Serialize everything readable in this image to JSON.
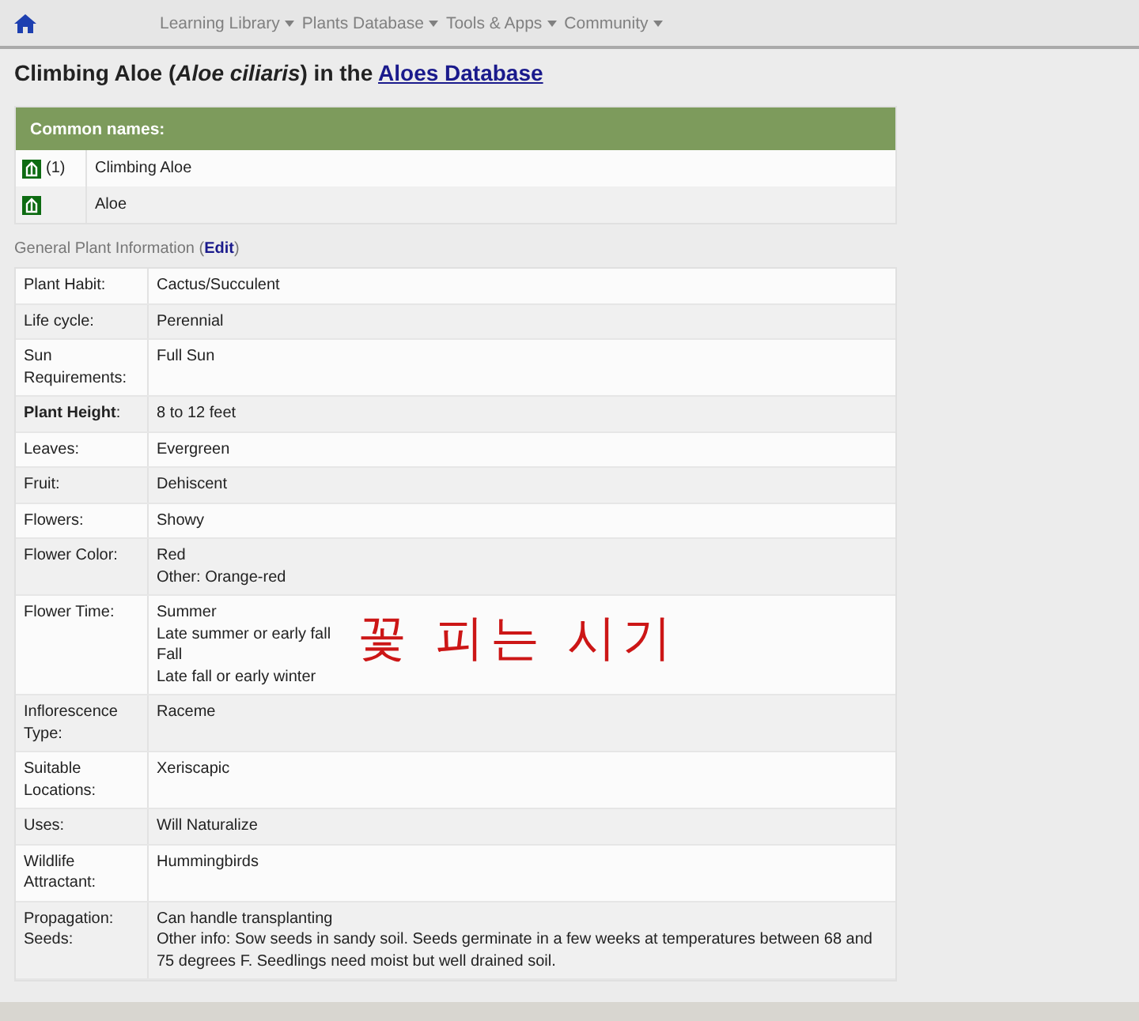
{
  "nav": {
    "menus": [
      "Learning Library",
      "Plants Database",
      "Tools & Apps",
      "Community"
    ]
  },
  "title": {
    "text": "Climbing Aloe (*Aloe ciliaris*) in the",
    "link": "Aloes Database"
  },
  "common_names": {
    "heading": "Common names:",
    "rows": [
      {
        "count": "(1)",
        "name": "Climbing Aloe"
      },
      {
        "name": "Aloe"
      }
    ]
  },
  "general": {
    "heading": "General Plant Information (",
    "edit": "Edit",
    "close": ")"
  },
  "info_rows": [
    {
      "label": "Plant Habit:",
      "values": [
        "Cactus/Succulent"
      ]
    },
    {
      "label": "Life cycle:",
      "values": [
        "Perennial"
      ]
    },
    {
      "label": "Sun Requirements:",
      "values": [
        "Full Sun"
      ]
    },
    {
      "label": "**Plant Height**:",
      "values": [
        "8 to 12 feet"
      ]
    },
    {
      "label": "Leaves:",
      "values": [
        "Evergreen"
      ]
    },
    {
      "label": "Fruit:",
      "values": [
        "Dehiscent"
      ]
    },
    {
      "label": "Flowers:",
      "values": [
        "Showy"
      ]
    },
    {
      "label": "Flower Color:",
      "values": [
        "Red",
        "Other: Orange-red"
      ]
    },
    {
      "label": "Flower Time:",
      "values": [
        "Summer",
        "Late summer or early fall",
        "Fall",
        "Late fall or early winter"
      ],
      "annotation": "꽃 피는 시기"
    },
    {
      "label": "Inflorescence Type:",
      "values": [
        "Raceme"
      ]
    },
    {
      "label": "Suitable Locations:",
      "values": [
        "Xeriscapic"
      ]
    },
    {
      "label": "Uses:",
      "values": [
        "Will Naturalize"
      ]
    },
    {
      "label": "Wildlife Attractant:",
      "values": [
        "Hummingbirds"
      ]
    },
    {
      "label": "Propagation: Seeds:",
      "values": [
        "Can handle transplanting",
        "Other info: Sow seeds in sandy soil. Seeds germinate in a few weeks at temperatures between 68 and 75 degrees F. Seedlings need moist but well drained soil."
      ]
    }
  ]
}
